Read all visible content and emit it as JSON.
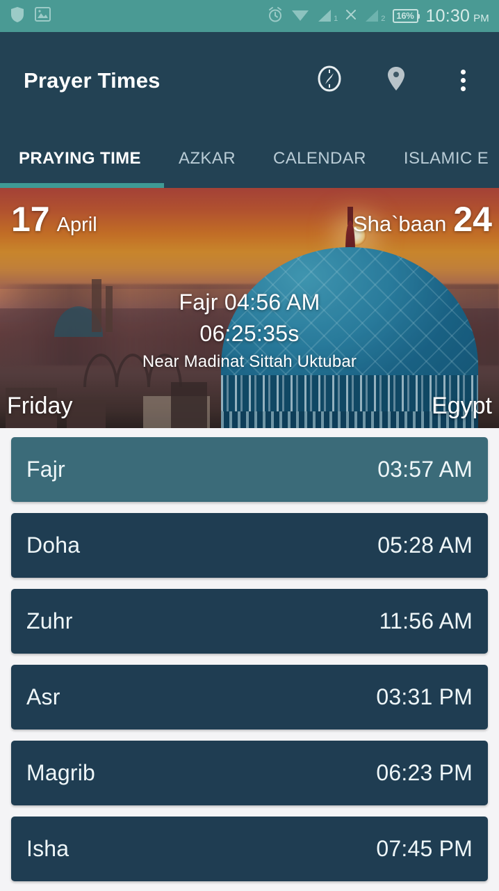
{
  "statusbar": {
    "icons_left": [
      "shield-icon",
      "photo-icon"
    ],
    "icons_right": [
      "alarm-icon",
      "wifi-icon",
      "signal-1-icon",
      "no-sim-icon",
      "signal-2-icon"
    ],
    "signal1_label": "1",
    "signal2_label": "2",
    "battery": "16%",
    "time": "10:30",
    "ampm": "PM"
  },
  "appbar": {
    "title": "Prayer Times",
    "actions": [
      {
        "name": "qibla-compass-icon",
        "label": "Qibla Compass"
      },
      {
        "name": "location-pin-icon",
        "label": "Location"
      },
      {
        "name": "overflow-menu-icon",
        "label": "More options"
      }
    ]
  },
  "tabs": [
    {
      "label": "PRAYING TIME",
      "active": true
    },
    {
      "label": "AZKAR",
      "active": false
    },
    {
      "label": "CALENDAR",
      "active": false
    },
    {
      "label": "ISLAMIC E",
      "active": false
    }
  ],
  "hero": {
    "gregorian_day": "17",
    "gregorian_month": "April",
    "hijri_month": "Sha`baan",
    "hijri_day": "24",
    "next_prayer": "Fajr 04:56 AM",
    "countdown": "06:25:35s",
    "location": "Near Madinat Sittah Uktubar",
    "weekday": "Friday",
    "country": "Egypt"
  },
  "prayers": [
    {
      "name": "Fajr",
      "time": "03:57 AM",
      "current": true
    },
    {
      "name": "Doha",
      "time": "05:28 AM",
      "current": false
    },
    {
      "name": "Zuhr",
      "time": "11:56 AM",
      "current": false
    },
    {
      "name": "Asr",
      "time": "03:31 PM",
      "current": false
    },
    {
      "name": "Magrib",
      "time": "06:23 PM",
      "current": false
    },
    {
      "name": "Isha",
      "time": "07:45 PM",
      "current": false
    }
  ],
  "colors": {
    "status_bar": "#4a9a94",
    "app_bar": "#234254",
    "tab_indicator": "#3f9a95",
    "row_default": "#1f3d52",
    "row_current": "#3b6b79",
    "list_background": "#f4f4f6"
  }
}
